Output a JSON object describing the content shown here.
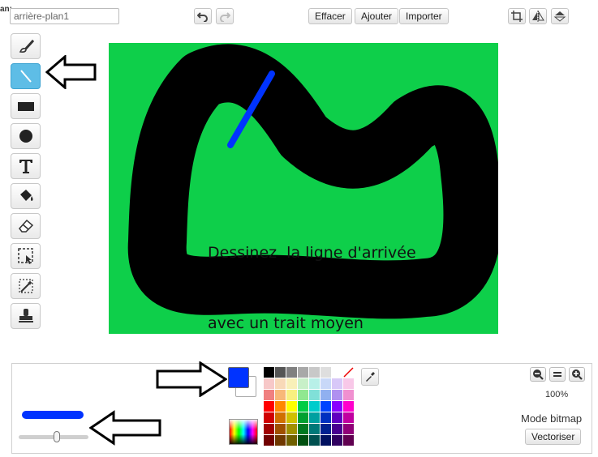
{
  "header": {
    "corner_label": "an:",
    "costume_name": "arrière-plan1",
    "clear_label": "Effacer",
    "add_label": "Ajouter",
    "import_label": "Importer"
  },
  "toolbar": {
    "tools": [
      "brush",
      "line",
      "rectangle",
      "ellipse",
      "text",
      "fill",
      "eraser",
      "select",
      "magic-select",
      "stamp"
    ],
    "active_tool": "line"
  },
  "canvas": {
    "background_color": "#0ecf4a",
    "annotation_line1": "Dessinez  la ligne d'arrivée",
    "annotation_line2": "avec un trait moyen"
  },
  "palette": {
    "primary_color": "#0033ff",
    "secondary_color": "#ffffff",
    "zoom_label": "100%",
    "mode_label": "Mode bitmap",
    "vectorize_label": "Vectoriser",
    "line_width_fraction": 0.55,
    "swatch_rows": [
      [
        "#000000",
        "#555555",
        "#808080",
        "#a8a8a8",
        "#c8c8c8",
        "#dedede",
        "#ffffff",
        "none"
      ],
      [
        "#f7c8c8",
        "#f8d9b8",
        "#f8f0b8",
        "#c8f0c8",
        "#b8f0e8",
        "#c8d8f8",
        "#d8c8f8",
        "#f8c8e8"
      ],
      [
        "#f08080",
        "#f8b878",
        "#f8f080",
        "#90e890",
        "#80e0d8",
        "#90b0f0",
        "#b090f0",
        "#f090d0"
      ],
      [
        "#ff0000",
        "#ff8800",
        "#ffff00",
        "#00cc44",
        "#00cccc",
        "#0044ff",
        "#8800ff",
        "#ff00cc"
      ],
      [
        "#d00000",
        "#d07000",
        "#d0c000",
        "#00a030",
        "#00a0a0",
        "#0030c0",
        "#6000c0",
        "#c000a0"
      ],
      [
        "#a00000",
        "#a05000",
        "#a09000",
        "#007a20",
        "#007878",
        "#002090",
        "#480090",
        "#900078"
      ],
      [
        "#700000",
        "#703800",
        "#706000",
        "#005010",
        "#005050",
        "#001060",
        "#300060",
        "#600050"
      ]
    ]
  }
}
